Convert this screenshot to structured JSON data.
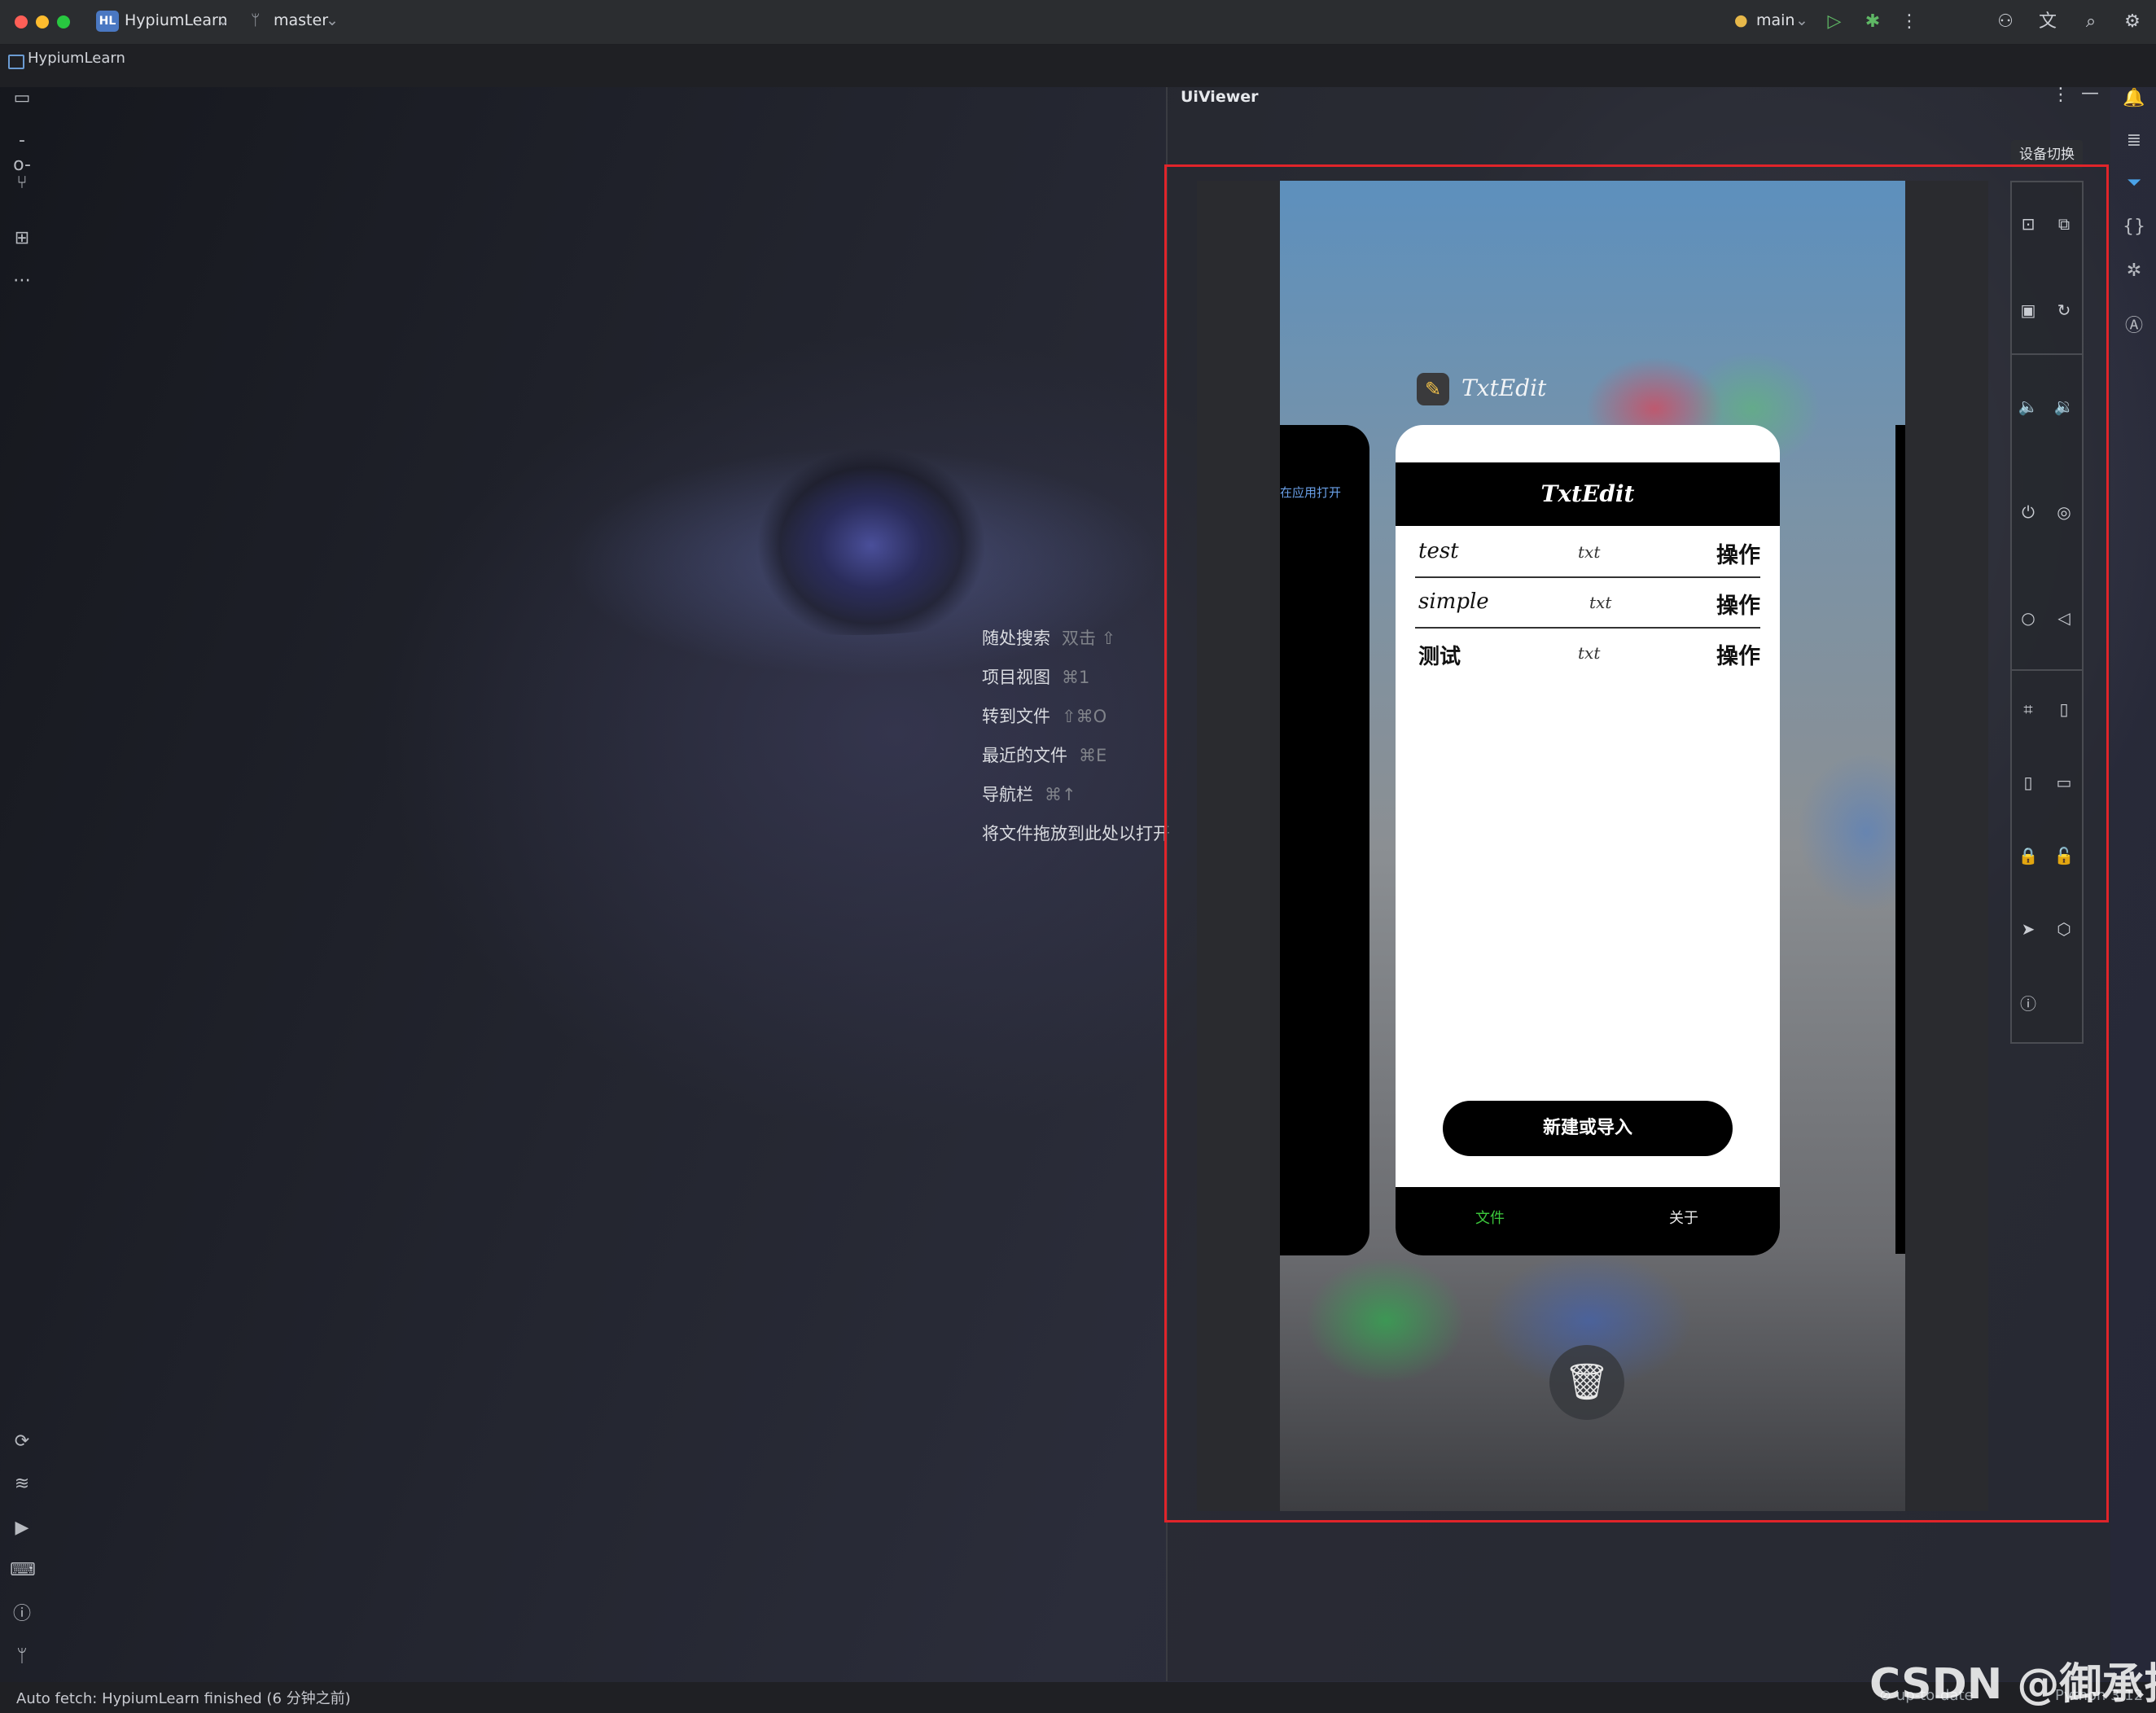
{
  "titlebar": {
    "project_badge": "HL",
    "project_name": "HypiumLearn",
    "branch": "master",
    "run_config": "main",
    "icons": [
      "run-icon",
      "debug-icon",
      "more-icon",
      "add-user-icon",
      "translate-icon",
      "search-icon",
      "settings-icon"
    ]
  },
  "project_strip": {
    "label": "HypiumLearn"
  },
  "welcome_hints": [
    {
      "label": "随处搜索",
      "shortcut": "双击 ⇧"
    },
    {
      "label": "项目视图",
      "shortcut": "⌘1"
    },
    {
      "label": "转到文件",
      "shortcut": "⇧⌘O"
    },
    {
      "label": "最近的文件",
      "shortcut": "⌘E"
    },
    {
      "label": "导航栏",
      "shortcut": "⌘↑"
    },
    {
      "label": "将文件拖放到此处以打开",
      "shortcut": ""
    }
  ],
  "uiviewer": {
    "title": "UiViewer",
    "device_switch": "设备切换",
    "left_card_text": "在应用打开",
    "app": {
      "name": "TxtEdit",
      "header": "TxtEdit",
      "files": [
        {
          "name": "test",
          "ext": "txt",
          "action": "操作"
        },
        {
          "name": "simple",
          "ext": "txt",
          "action": "操作"
        },
        {
          "name": "测试",
          "ext": "txt",
          "action": "操作"
        }
      ],
      "new_button": "新建或导入",
      "nav": [
        {
          "label": "文件",
          "active": true
        },
        {
          "label": "关于",
          "active": false
        }
      ]
    }
  },
  "status": {
    "text": "Auto fetch: HypiumLearn finished (6 分钟之前)",
    "right": "⊘ up-to-date",
    "python": "Python 3.12"
  },
  "watermark": "CSDN @御承扬",
  "colors": {
    "highlight_border": "#e0242a",
    "nav_active": "#3cc83c",
    "accent_blue": "#4a78c2"
  }
}
